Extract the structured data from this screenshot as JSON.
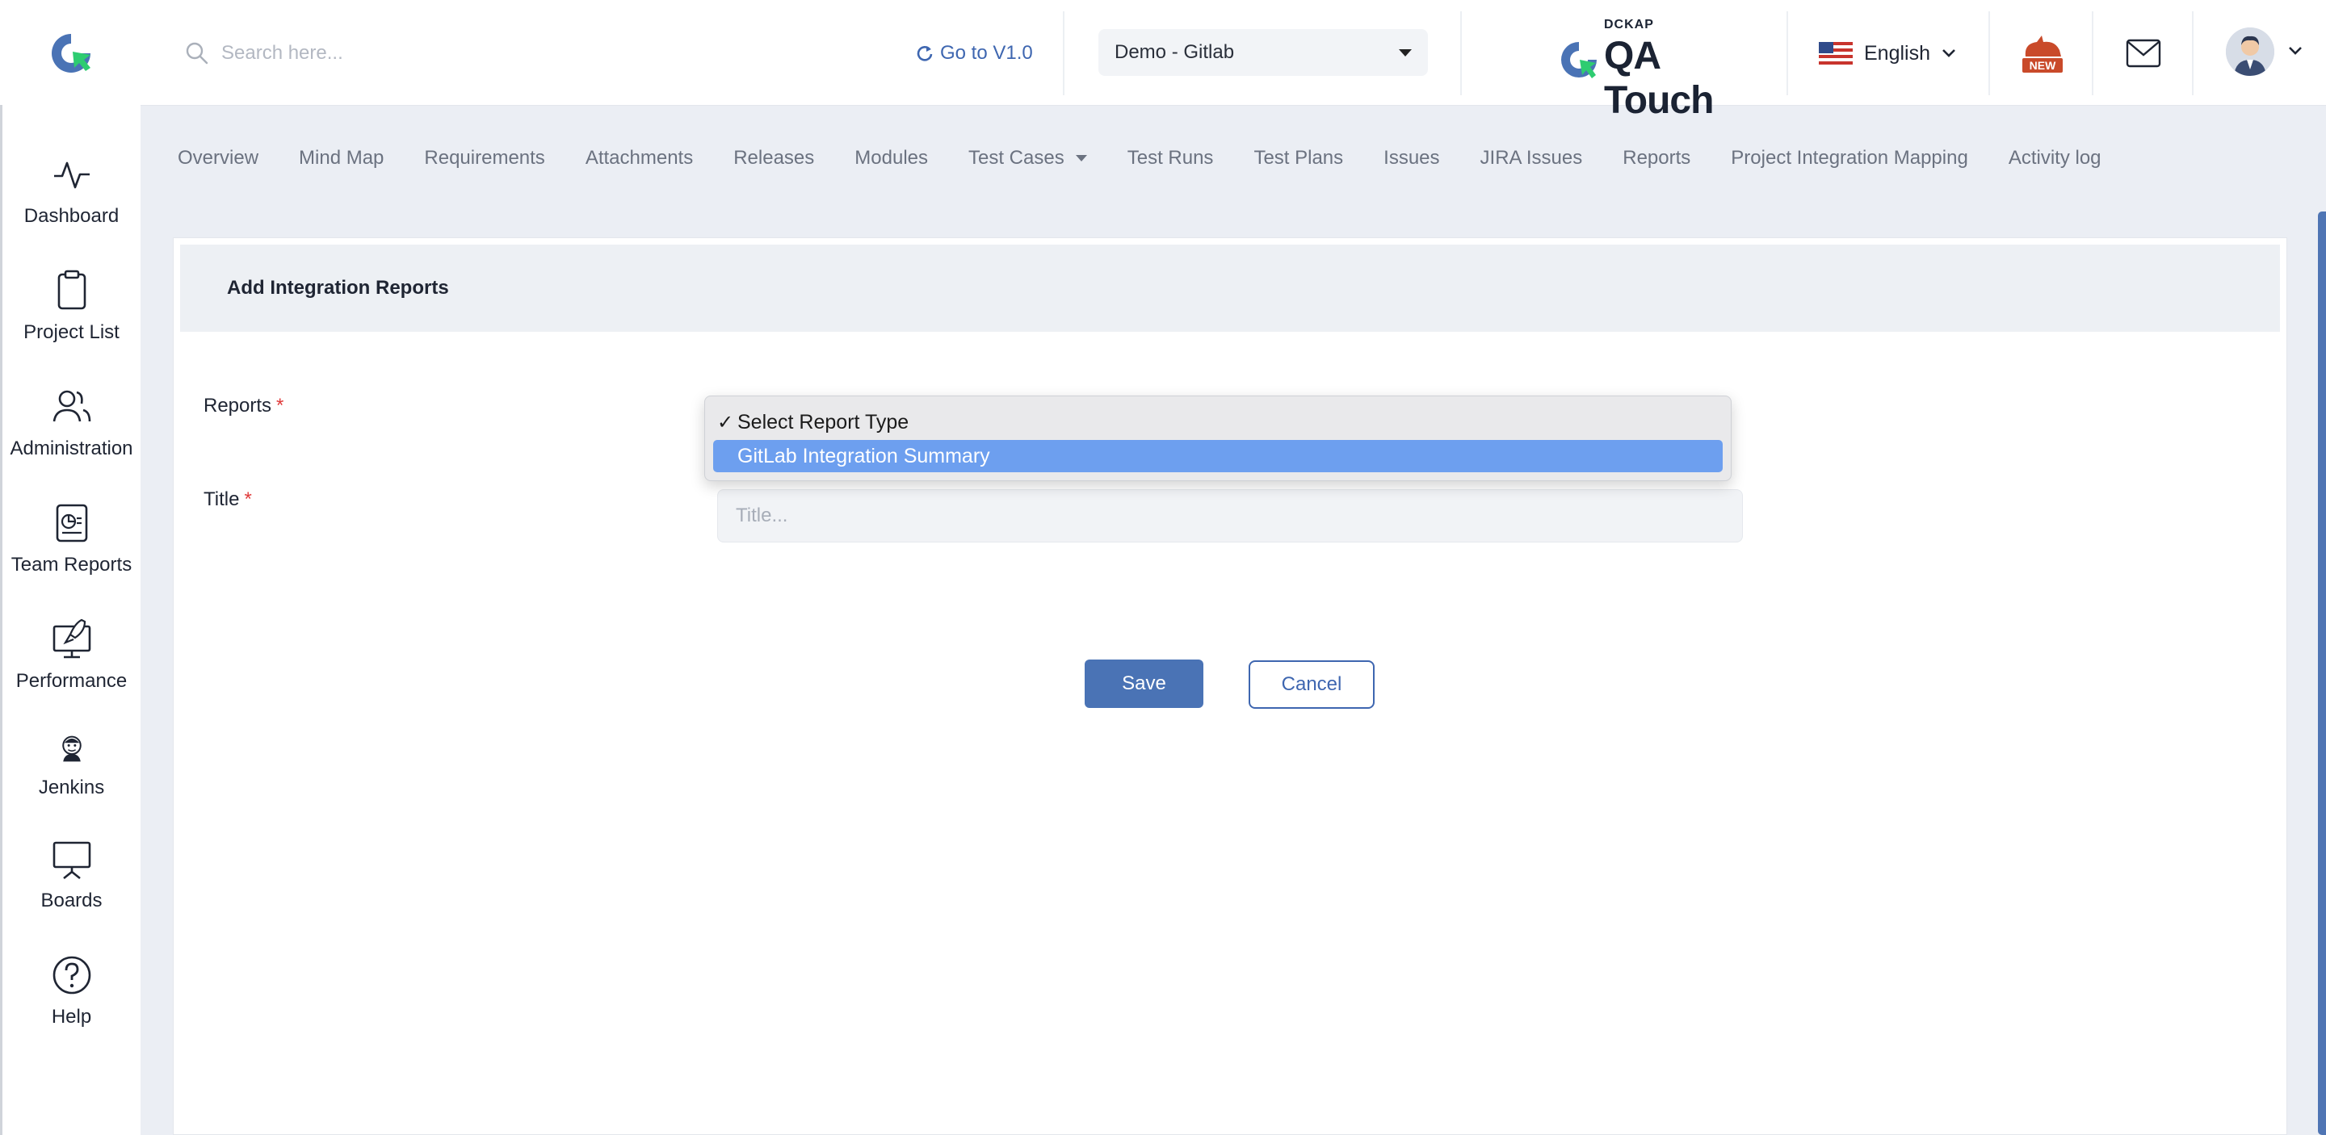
{
  "header": {
    "search_placeholder": "Search here...",
    "goto_label": "Go to V1.0",
    "project_selected": "Demo - Gitlab",
    "brand_top": "DCKAP",
    "brand_name": "QA Touch",
    "language": "English",
    "new_badge_text": "NEW"
  },
  "sidebar": {
    "items": [
      {
        "label": "Dashboard",
        "icon": "pulse-icon"
      },
      {
        "label": "Project List",
        "icon": "clipboard-icon"
      },
      {
        "label": "Administration",
        "icon": "users-icon"
      },
      {
        "label": "Team Reports",
        "icon": "report-icon"
      },
      {
        "label": "Performance",
        "icon": "monitor-rocket-icon"
      },
      {
        "label": "Jenkins",
        "icon": "jenkins-icon"
      },
      {
        "label": "Boards",
        "icon": "board-icon"
      },
      {
        "label": "Help",
        "icon": "help-icon"
      }
    ]
  },
  "tabs": [
    "Overview",
    "Mind Map",
    "Requirements",
    "Attachments",
    "Releases",
    "Modules",
    "Test Cases",
    "Test Runs",
    "Test Plans",
    "Issues",
    "JIRA Issues",
    "Reports",
    "Project Integration Mapping",
    "Activity log"
  ],
  "form": {
    "heading": "Add Integration Reports",
    "reports_label": "Reports",
    "title_label": "Title",
    "required_mark": "*",
    "title_placeholder": "Title...",
    "report_options": [
      "Select Report Type",
      "GitLab Integration Summary"
    ],
    "option_check": "✓",
    "save_label": "Save",
    "cancel_label": "Cancel"
  },
  "colors": {
    "accent": "#4a73b5",
    "highlight": "#6d9fef",
    "required": "#e03b3b",
    "logo_green": "#2ecc71"
  }
}
